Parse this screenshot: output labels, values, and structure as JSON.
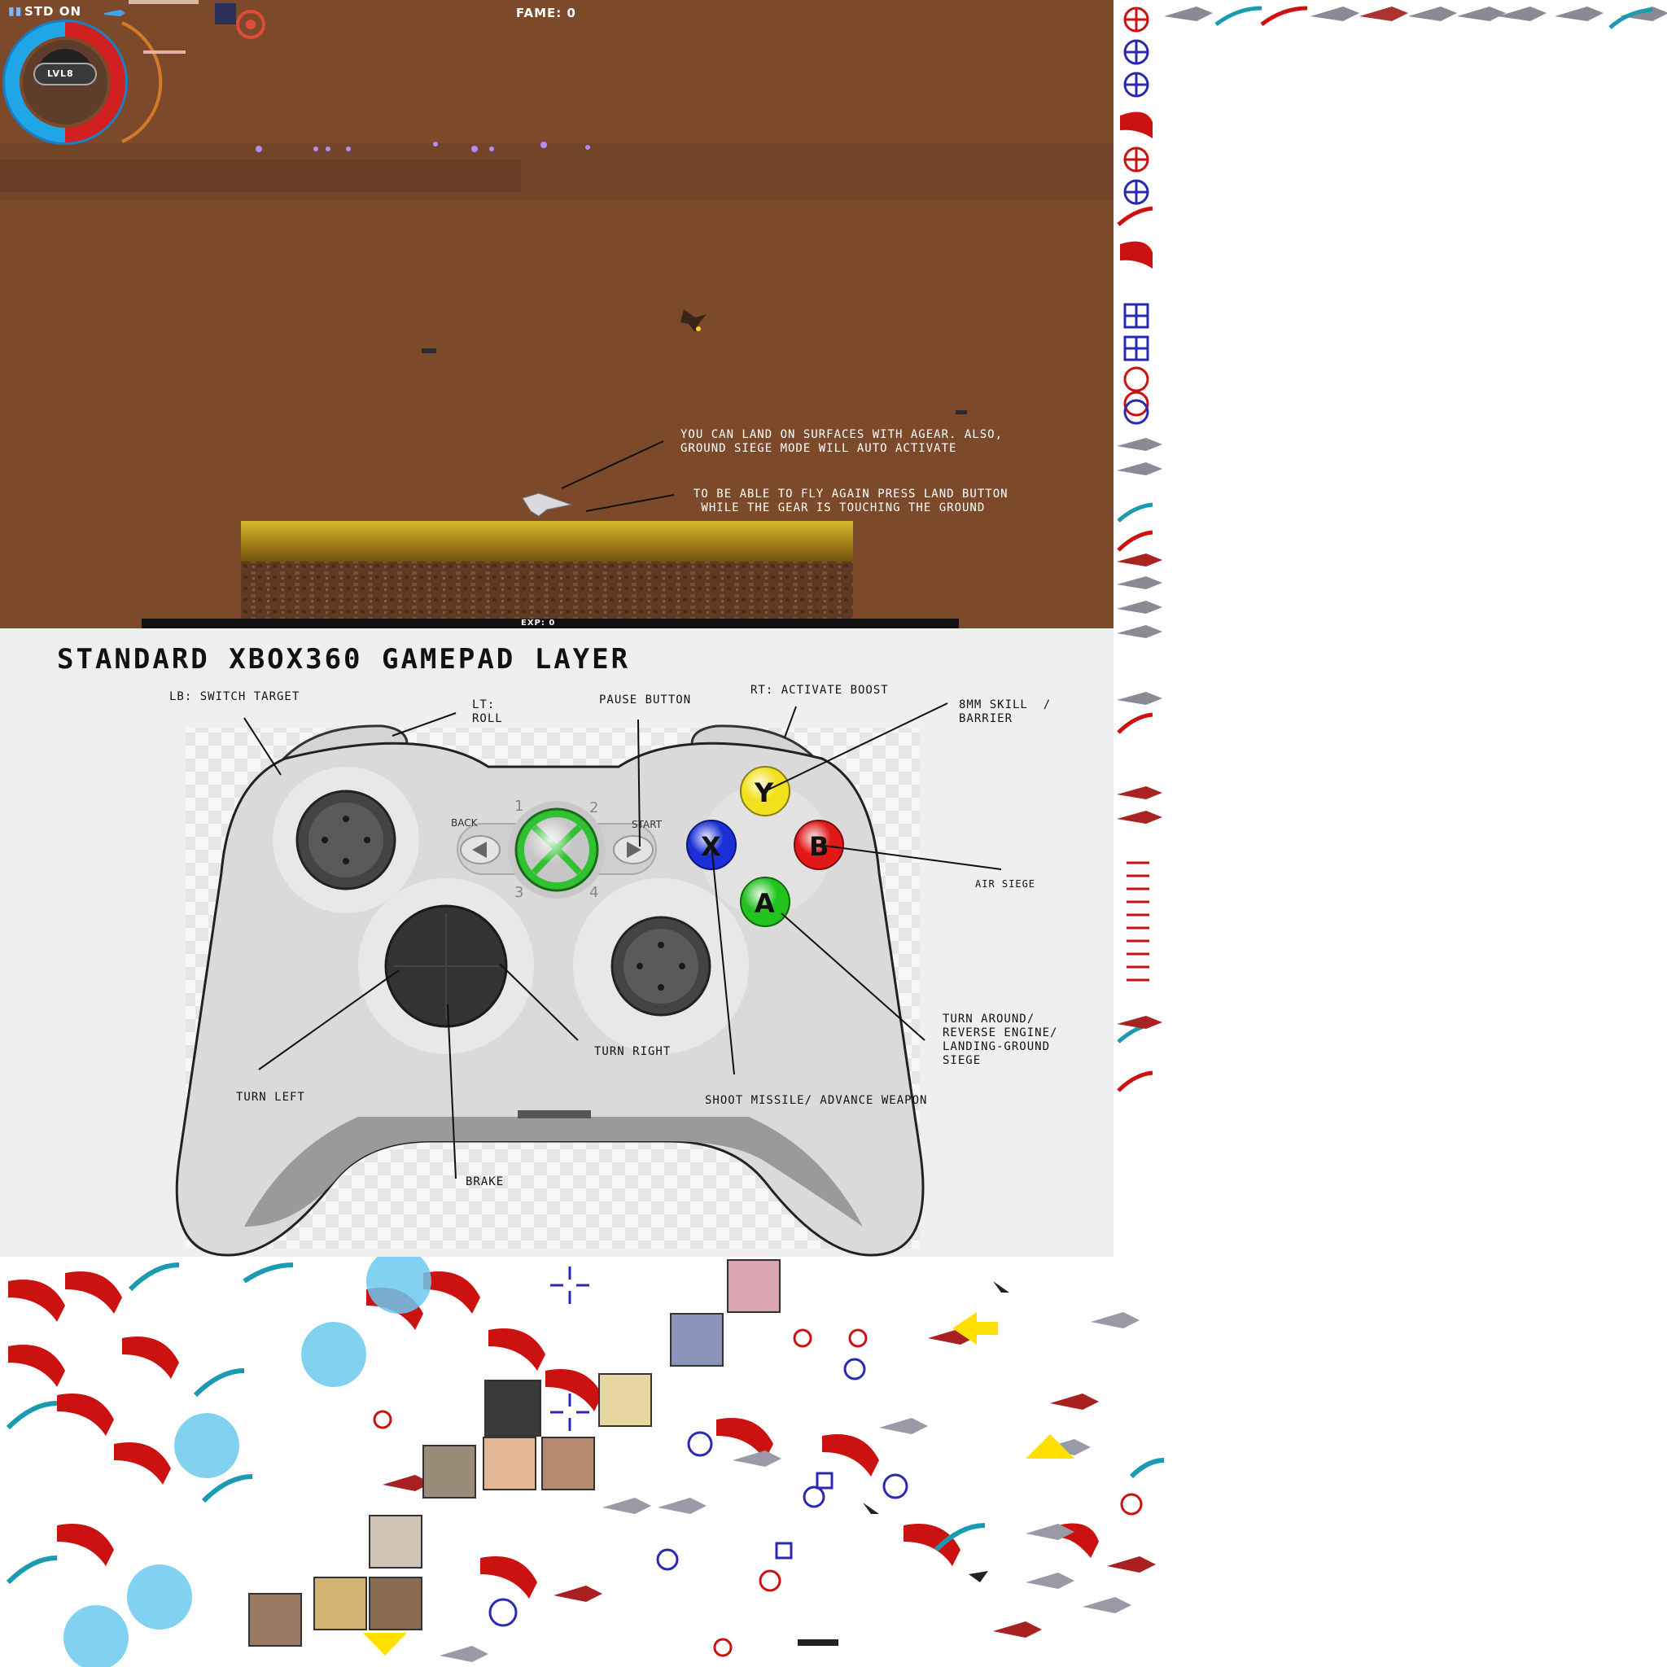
{
  "hud": {
    "status": "STD ON",
    "level": "LVL8",
    "fame": "FAME: 0",
    "exp": "EXP: 0"
  },
  "notes": {
    "land": "YOU CAN LAND ON SURFACES WITH AGEAR. ALSO,\nGROUND SIEGE MODE WILL AUTO ACTIVATE",
    "fly": "TO BE ABLE TO FLY AGAIN PRESS LAND BUTTON\n WHILE THE GEAR IS TOUCHING THE GROUND"
  },
  "gamepad": {
    "title": "STANDARD XBOX360 GAMEPAD LAYER",
    "labels": {
      "lb": "LB: SWITCH TARGET",
      "lt": "LT:\nROLL",
      "pause": "PAUSE BUTTON",
      "rt": "RT: ACTIVATE BOOST",
      "y": "8MM SKILL  /\nBARRIER",
      "b": "AIR SIEGE",
      "a": "TURN AROUND/\nREVERSE ENGINE/\nLANDING-GROUND\nSIEGE",
      "x": "SHOOT MISSILE/ ADVANCE WEAPON",
      "turn_left": "TURN LEFT",
      "turn_right": "TURN RIGHT",
      "brake": "BRAKE"
    },
    "buttons": {
      "y": "Y",
      "x": "X",
      "b": "B",
      "a": "A"
    },
    "center": {
      "back": "BACK",
      "start": "START",
      "n1": "1",
      "n2": "2",
      "n3": "3",
      "n4": "4"
    },
    "colors": {
      "y": "#f2e21c",
      "x": "#1a2fd6",
      "b": "#e01818",
      "a": "#22c21f",
      "guide": "#2fc12f"
    }
  },
  "sprites": {
    "colors": {
      "red": "#cc1111",
      "teal": "#1a9bb0",
      "blue": "#2a2ab0",
      "bubble": "#6cc9ee",
      "yellow": "#ffe000"
    }
  }
}
